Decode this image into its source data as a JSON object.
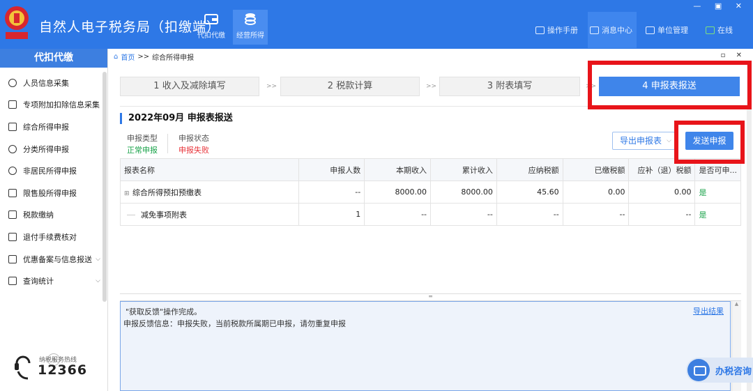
{
  "app": {
    "title": "自然人电子税务局（扣缴端）",
    "window_controls": "— ▣ ✕"
  },
  "top_nav": [
    {
      "label": "代扣代缴",
      "icon": "wallet-icon",
      "active": false
    },
    {
      "label": "经营所得",
      "icon": "coins-icon",
      "active": true
    }
  ],
  "right_menu": [
    {
      "label": "操作手册",
      "icon": "manual-icon"
    },
    {
      "label": "消息中心",
      "icon": "mail-icon"
    },
    {
      "label": "单位管理",
      "icon": "building-icon"
    },
    {
      "label": "在线",
      "icon": "monitor-icon"
    }
  ],
  "sidebar": {
    "header": "代扣代缴",
    "items": [
      {
        "label": "人员信息采集",
        "icon": "person-icon"
      },
      {
        "label": "专项附加扣除信息采集",
        "icon": "list-icon"
      },
      {
        "label": "综合所得申报",
        "icon": "layers-icon"
      },
      {
        "label": "分类所得申报",
        "icon": "pie-icon"
      },
      {
        "label": "非居民所得申报",
        "icon": "person-icon"
      },
      {
        "label": "限售股所得申报",
        "icon": "bar-chart-icon"
      },
      {
        "label": "税款缴纳",
        "icon": "wallet-icon"
      },
      {
        "label": "退付手续费核对",
        "icon": "doc-icon"
      },
      {
        "label": "优惠备案与信息报送",
        "icon": "file-icon",
        "expandable": true
      },
      {
        "label": "查询统计",
        "icon": "search-list-icon",
        "expandable": true
      }
    ],
    "collapse": "«",
    "hotline_label": "纳税服务热线",
    "hotline_number": "12366"
  },
  "breadcrumb": {
    "home": "首页",
    "separator": ">>",
    "current": "综合所得申报"
  },
  "main_window_controls": "▫ ✕",
  "steps": [
    {
      "label": "1 收入及减除填写",
      "active": false
    },
    {
      "label": "2 税款计算",
      "active": false
    },
    {
      "label": "3 附表填写",
      "active": false
    },
    {
      "label": "4 申报表报送",
      "active": true
    }
  ],
  "step_separator": ">>",
  "period": {
    "title": "2022年09月  申报表报送"
  },
  "meta": {
    "type_label": "申报类型",
    "type_value": "正常申报",
    "status_label": "申报状态",
    "status_value": "申报失败"
  },
  "buttons": {
    "export": "导出申报表",
    "send": "发送申报"
  },
  "table": {
    "headers": [
      "报表名称",
      "申报人数",
      "本期收入",
      "累计收入",
      "应纳税额",
      "已缴税额",
      "应补（退）税额",
      "是否可申..."
    ],
    "rows": [
      {
        "name": "综合所得预扣预缴表",
        "count": "--",
        "income": "8000.00",
        "cumulative": "8000.00",
        "tax_due": "45.60",
        "tax_paid": "0.00",
        "refund": "0.00",
        "can_file": "是"
      },
      {
        "name": "减免事项附表",
        "count": "1",
        "income": "--",
        "cumulative": "--",
        "tax_due": "--",
        "tax_paid": "--",
        "refund": "--",
        "can_file": "是"
      }
    ]
  },
  "feedback": {
    "line1": "\"获取反馈\"操作完成。",
    "line2": "申报反馈信息：申报失败，当前税款所属期已申报，请勿重复申报",
    "export_link": "导出结果"
  },
  "consult": {
    "label": "办税咨询"
  },
  "colors": {
    "brand": "#2e78e6",
    "highlight": "#e8141a",
    "success": "#1aa34a",
    "error": "#e8343a"
  }
}
